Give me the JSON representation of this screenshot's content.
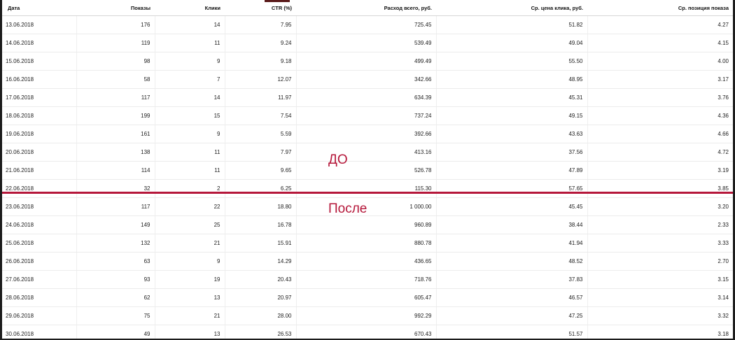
{
  "table": {
    "headers": [
      "Дата",
      "Показы",
      "Клики",
      "CTR (%)",
      "Расход всего, руб.",
      "Ср. цена клика, руб.",
      "Ср. позиция показа"
    ],
    "rows": [
      [
        "13.06.2018",
        "176",
        "14",
        "7.95",
        "725.45",
        "51.82",
        "4.27"
      ],
      [
        "14.06.2018",
        "119",
        "11",
        "9.24",
        "539.49",
        "49.04",
        "4.15"
      ],
      [
        "15.06.2018",
        "98",
        "9",
        "9.18",
        "499.49",
        "55.50",
        "4.00"
      ],
      [
        "16.06.2018",
        "58",
        "7",
        "12.07",
        "342.66",
        "48.95",
        "3.17"
      ],
      [
        "17.06.2018",
        "117",
        "14",
        "11.97",
        "634.39",
        "45.31",
        "3.76"
      ],
      [
        "18.06.2018",
        "199",
        "15",
        "7.54",
        "737.24",
        "49.15",
        "4.36"
      ],
      [
        "19.06.2018",
        "161",
        "9",
        "5.59",
        "392.66",
        "43.63",
        "4.66"
      ],
      [
        "20.06.2018",
        "138",
        "11",
        "7.97",
        "413.16",
        "37.56",
        "4.72"
      ],
      [
        "21.06.2018",
        "114",
        "11",
        "9.65",
        "526.78",
        "47.89",
        "3.19"
      ],
      [
        "22.06.2018",
        "32",
        "2",
        "6.25",
        "115.30",
        "57.65",
        "3.85"
      ],
      [
        "23.06.2018",
        "117",
        "22",
        "18.80",
        "1 000.00",
        "45.45",
        "3.20"
      ],
      [
        "24.06.2018",
        "149",
        "25",
        "16.78",
        "960.89",
        "38.44",
        "2.33"
      ],
      [
        "25.06.2018",
        "132",
        "21",
        "15.91",
        "880.78",
        "41.94",
        "3.33"
      ],
      [
        "26.06.2018",
        "63",
        "9",
        "14.29",
        "436.65",
        "48.52",
        "2.70"
      ],
      [
        "27.06.2018",
        "93",
        "19",
        "20.43",
        "718.76",
        "37.83",
        "3.15"
      ],
      [
        "28.06.2018",
        "62",
        "13",
        "20.97",
        "605.47",
        "46.57",
        "3.14"
      ],
      [
        "29.06.2018",
        "75",
        "21",
        "28.00",
        "992.29",
        "47.25",
        "3.32"
      ],
      [
        "30.06.2018",
        "49",
        "13",
        "26.53",
        "670.43",
        "51.57",
        "3.18"
      ]
    ]
  },
  "annotations": {
    "before": "ДО",
    "after": "После"
  },
  "colors": {
    "accent": "#b5173a"
  }
}
